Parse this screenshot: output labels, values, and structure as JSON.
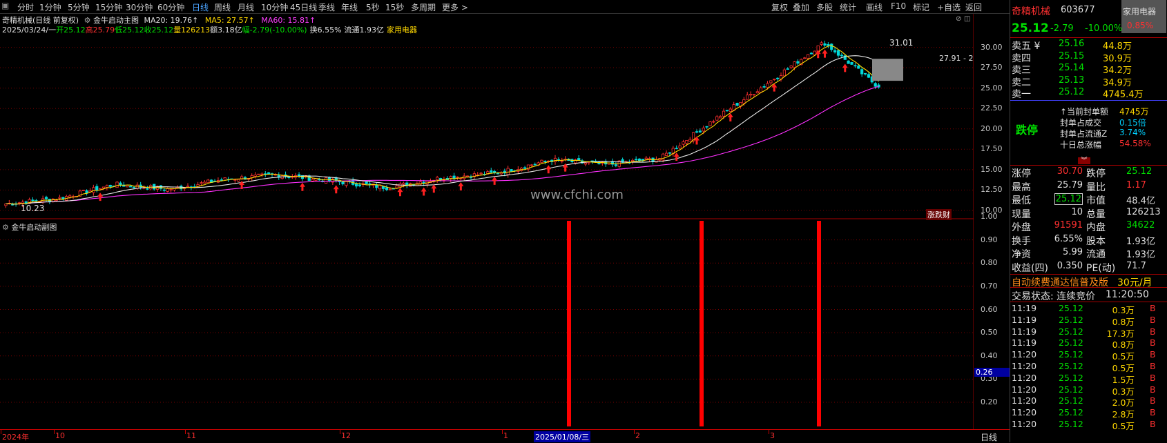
{
  "topbar": {
    "periods": [
      "分时",
      "1分钟",
      "5分钟",
      "15分钟",
      "30分钟",
      "60分钟",
      "日线",
      "周线",
      "月线",
      "10分钟",
      "45日线",
      "季线",
      "年线",
      "5秒",
      "15秒",
      "多周期",
      "更多 >"
    ],
    "active_period": "日线",
    "tools": [
      "复权",
      "叠加",
      "多股",
      "统计",
      "画线",
      "F10",
      "标记",
      "+自选",
      "返回"
    ]
  },
  "main": {
    "title": "奇精机械(日线 前复权)",
    "indicator_name": "金牛启动主图",
    "ma20": "MA20: 19.76↑",
    "ma5": "MA5: 27.57↑",
    "ma60": "MA60: 15.81↑",
    "info_date": "2025/03/24/一",
    "open": "开25.12",
    "high": "高25.79",
    "low": "低25.12",
    "close": "收25.12",
    "vol": "量126213",
    "amount": "额3.18亿",
    "change": "幅-2.79(-10.00%)",
    "turnover": "换6.55%",
    "float": "流通1.93亿",
    "sector": "家用电器",
    "y_ticks": [
      "30.00",
      "27.50",
      "25.00",
      "22.50",
      "20.00",
      "17.50",
      "15.00",
      "12.50",
      "10.00"
    ],
    "peak_label": "31.01",
    "low_label": "10.23",
    "cursor_label": "27.91 - 2",
    "watermark": "www.cfchi.com",
    "zd_label": "涨跌财"
  },
  "sub": {
    "title": "金牛启动副图",
    "y_ticks": [
      "1.00",
      "0.90",
      "0.80",
      "0.70",
      "0.60",
      "0.50",
      "0.40",
      "0.30",
      "0.20"
    ],
    "value_label": "0.26"
  },
  "x_axis": {
    "labels": [
      "2024年",
      "10",
      "11",
      "12",
      "1",
      "2025/01/08/三",
      "2",
      "3"
    ],
    "right_label": "日线"
  },
  "chart_data": {
    "type": "candlestick",
    "x": [
      "2024-09",
      "2024-10",
      "2024-11",
      "2024-12",
      "2025-01",
      "2025-02",
      "2025-03"
    ],
    "price_range": [
      10.0,
      31.0
    ],
    "y_ticks": [
      10.0,
      12.5,
      15.0,
      17.5,
      20.0,
      22.5,
      25.0,
      27.5,
      30.0
    ],
    "close_approx": [
      10.8,
      11.5,
      13.2,
      12.6,
      13.8,
      14.4,
      13.6,
      12.8,
      14.0,
      14.6,
      16.2,
      15.6,
      16.4,
      21.2,
      25.8,
      30.6,
      25.12
    ],
    "ma5_last": 27.57,
    "ma20_last": 19.76,
    "ma60_last": 15.81,
    "high_marker": 31.01,
    "low_marker": 10.23,
    "subchart_signal": [
      {
        "date": "2025-01",
        "value": 1.0
      },
      {
        "date": "2025-02",
        "value": 1.0
      },
      {
        "date": "2025-03",
        "value": 1.0
      }
    ],
    "subchart_last": 0.26
  },
  "panel": {
    "name": "奇精机械",
    "code": "603677",
    "sector_badge": "家用电器",
    "sector_pct": "0.85%",
    "price": "25.12",
    "change": "-2.79",
    "change_pct": "-10.00%",
    "asks": [
      {
        "label": "卖五 ¥",
        "price": "25.16",
        "vol": "44.8万"
      },
      {
        "label": "卖四",
        "price": "25.15",
        "vol": "30.9万"
      },
      {
        "label": "卖三",
        "price": "25.14",
        "vol": "34.2万"
      },
      {
        "label": "卖二",
        "price": "25.13",
        "vol": "34.9万"
      },
      {
        "label": "卖一",
        "price": "25.12",
        "vol": "4745.4万"
      }
    ],
    "limit_status": "跌停",
    "limit_info": [
      {
        "label": "↑当前封单额",
        "value": "4745万"
      },
      {
        "label": "封单占成交",
        "value": "0.15倍"
      },
      {
        "label": "封单占流通Z",
        "value": "3.74%"
      },
      {
        "label": "十日总涨幅",
        "value": "54.58%"
      }
    ],
    "stats": [
      {
        "l1": "涨停",
        "v1": "30.70",
        "l2": "跌停",
        "v2": "25.12"
      },
      {
        "l1": "最高",
        "v1": "25.79",
        "l2": "量比",
        "v2": "1.17"
      },
      {
        "l1": "最低",
        "v1": "25.12",
        "l2": "市值",
        "v2": "48.4亿"
      },
      {
        "l1": "现量",
        "v1": "10",
        "l2": "总量",
        "v2": "126213"
      },
      {
        "l1": "外盘",
        "v1": "91591",
        "l2": "内盘",
        "v2": "34622"
      },
      {
        "l1": "换手",
        "v1": "6.55%",
        "l2": "股本",
        "v2": "1.93亿"
      },
      {
        "l1": "净资",
        "v1": "5.99",
        "l2": "流通",
        "v2": "1.93亿"
      },
      {
        "l1": "收益(四)",
        "v1": "0.350",
        "l2": "PE(动)",
        "v2": "71.7"
      }
    ],
    "ad_text": "自动续费通达信普及版",
    "ad_price": "30元/月",
    "trade_status": "交易状态: 连续竞价",
    "trade_time": "11:20:50",
    "ticks": [
      {
        "t": "11:19",
        "p": "25.12",
        "v": "0.3万",
        "s": "B"
      },
      {
        "t": "11:19",
        "p": "25.12",
        "v": "0.8万",
        "s": "B"
      },
      {
        "t": "11:19",
        "p": "25.12",
        "v": "17.3万",
        "s": "B"
      },
      {
        "t": "11:19",
        "p": "25.12",
        "v": "0.8万",
        "s": "B"
      },
      {
        "t": "11:20",
        "p": "25.12",
        "v": "0.5万",
        "s": "B"
      },
      {
        "t": "11:20",
        "p": "25.12",
        "v": "0.5万",
        "s": "B"
      },
      {
        "t": "11:20",
        "p": "25.12",
        "v": "1.5万",
        "s": "B"
      },
      {
        "t": "11:20",
        "p": "25.12",
        "v": "0.3万",
        "s": "B"
      },
      {
        "t": "11:20",
        "p": "25.12",
        "v": "2.0万",
        "s": "B"
      },
      {
        "t": "11:20",
        "p": "25.12",
        "v": "2.8万",
        "s": "B"
      },
      {
        "t": "11:20",
        "p": "25.12",
        "v": "0.5万",
        "s": "B"
      }
    ]
  }
}
